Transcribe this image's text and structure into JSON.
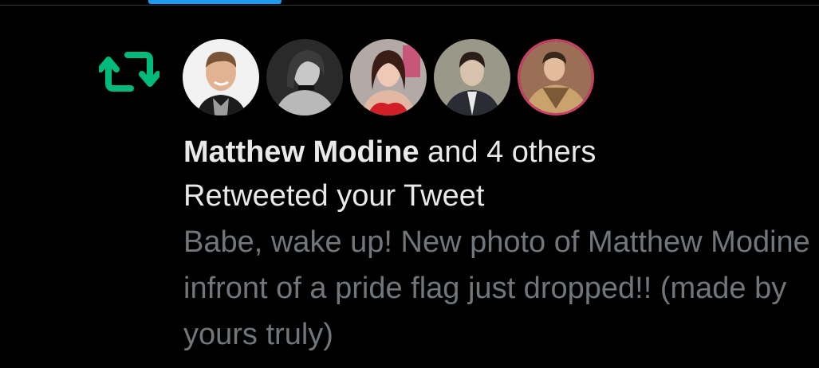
{
  "notification": {
    "type_icon": "retweet-icon",
    "accent_color": "#00ba7c",
    "avatars": [
      {
        "icon": "avatar-photo-man-smiling"
      },
      {
        "icon": "avatar-photo-woman-bw"
      },
      {
        "icon": "avatar-photo-woman-red-dress"
      },
      {
        "icon": "avatar-photo-man-suit"
      },
      {
        "icon": "avatar-photo-man-costume"
      }
    ],
    "actor_name": "Matthew Modine",
    "others_text": " and 4 others",
    "action_text": "Retweeted your Tweet",
    "tweet_text": "Babe, wake up! New photo of Matthew Modine infront of a pride flag just dropped!! (made by yours truly)"
  }
}
